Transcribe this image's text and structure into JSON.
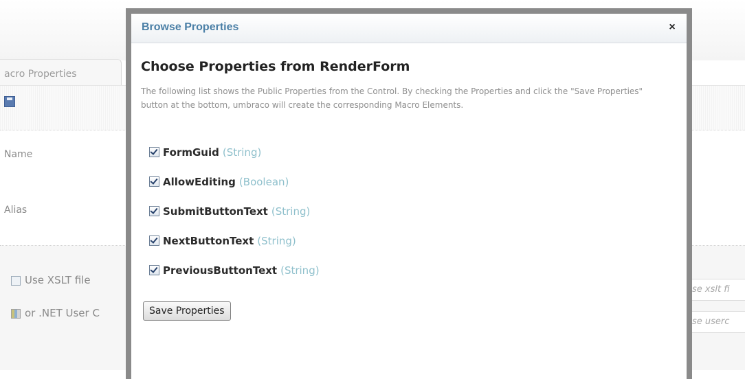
{
  "background": {
    "tab_label": "acro Properties",
    "name_label": "Name",
    "alias_label": "Alias",
    "xslt_label": "Use XSLT file",
    "usercontrol_label": "or .NET User C",
    "xslt_browse_hint": "se xslt fi",
    "usercontrol_browse_hint": "se userc"
  },
  "modal": {
    "title": "Browse Properties",
    "close_glyph": "×",
    "heading": "Choose Properties from RenderForm",
    "description": "The following list shows the Public Properties from the Control. By checking the Properties and click the \"Save Properties\" button at the bottom, umbraco will create the corresponding Macro Elements.",
    "properties": [
      {
        "name": "FormGuid",
        "type": "(String)",
        "checked": true
      },
      {
        "name": "AllowEditing",
        "type": "(Boolean)",
        "checked": true
      },
      {
        "name": "SubmitButtonText",
        "type": "(String)",
        "checked": true
      },
      {
        "name": "NextButtonText",
        "type": "(String)",
        "checked": true
      },
      {
        "name": "PreviousButtonText",
        "type": "(String)",
        "checked": true
      }
    ],
    "save_button_label": "Save Properties"
  },
  "icons": {
    "save": "save-icon",
    "close": "close-icon",
    "xslt_file": "xslt-file-icon",
    "dll": "dll-icon",
    "checkbox": "checkbox-checked-icon"
  },
  "colors": {
    "title_blue": "#4a7fa6",
    "type_teal": "#8fc0cc",
    "description_gray": "#8e8e8e",
    "modal_frame": "#8a8a8a"
  }
}
